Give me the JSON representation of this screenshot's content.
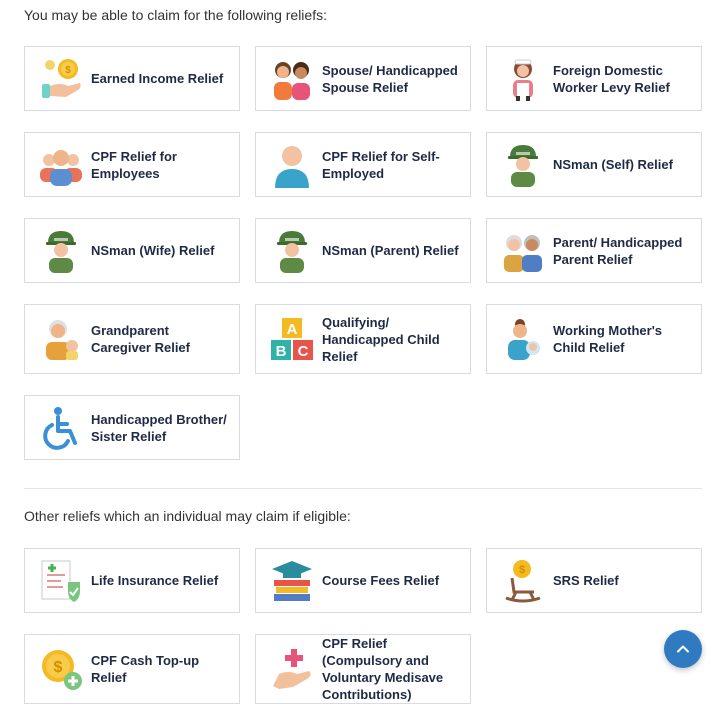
{
  "section1": {
    "heading": "You may be able to claim for the following reliefs:",
    "cards": [
      {
        "label": "Earned Income Relief",
        "icon": "earned-income-icon"
      },
      {
        "label": "Spouse/ Handicapped Spouse Relief",
        "icon": "spouse-icon"
      },
      {
        "label": "Foreign Domestic Worker Levy Relief",
        "icon": "domestic-worker-icon"
      },
      {
        "label": "CPF Relief for Employees",
        "icon": "employees-icon"
      },
      {
        "label": "CPF Relief for Self-Employed",
        "icon": "self-employed-icon"
      },
      {
        "label": "NSman (Self) Relief",
        "icon": "nsman-soldier-icon"
      },
      {
        "label": "NSman (Wife) Relief",
        "icon": "nsman-soldier-icon"
      },
      {
        "label": "NSman (Parent) Relief",
        "icon": "nsman-soldier-icon"
      },
      {
        "label": "Parent/ Handicapped Parent Relief",
        "icon": "elderly-parents-icon"
      },
      {
        "label": "Grandparent Caregiver Relief",
        "icon": "grandparent-icon"
      },
      {
        "label": "Qualifying/ Handicapped Child Relief",
        "icon": "abc-blocks-icon"
      },
      {
        "label": "Working Mother's Child Relief",
        "icon": "mother-baby-icon"
      },
      {
        "label": "Handicapped Brother/ Sister Relief",
        "icon": "wheelchair-icon"
      }
    ]
  },
  "section2": {
    "heading": "Other reliefs which an individual may claim if eligible:",
    "cards": [
      {
        "label": "Life Insurance Relief",
        "icon": "insurance-shield-icon"
      },
      {
        "label": "Course Fees Relief",
        "icon": "graduation-books-icon"
      },
      {
        "label": "SRS Relief",
        "icon": "rocking-chair-coin-icon"
      },
      {
        "label": "CPF Cash Top-up Relief",
        "icon": "dollar-coin-plus-icon"
      },
      {
        "label": "CPF Relief (Compulsory and Voluntary Medisave Contributions)",
        "icon": "hand-cross-icon"
      }
    ]
  },
  "scroll_top": {
    "icon": "chevron-up-icon"
  },
  "colors": {
    "accent": "#2f7ac0",
    "text": "#1f2a44",
    "border": "#d8dbe0"
  }
}
